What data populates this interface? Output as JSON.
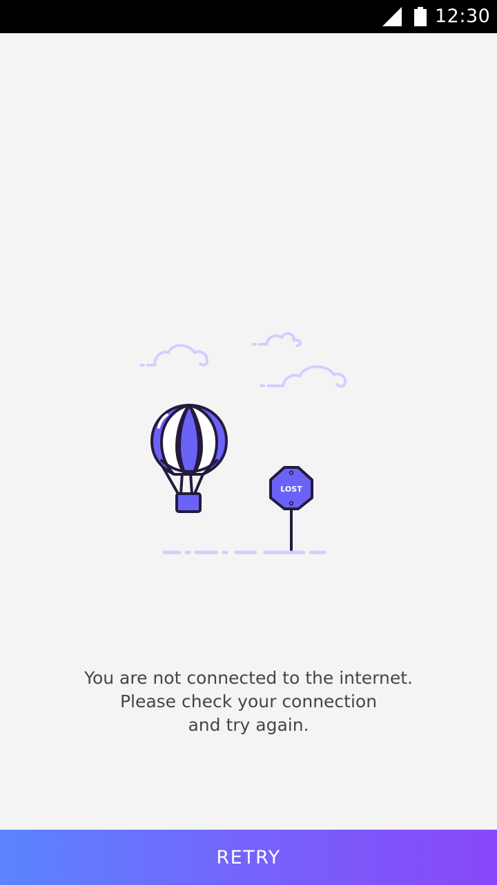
{
  "status_bar": {
    "time": "12:30",
    "icons": [
      "signal-icon",
      "battery-icon"
    ]
  },
  "illustration": {
    "sign_text": "LOST",
    "icons": [
      "cloud-icon",
      "hot-air-balloon-icon",
      "stop-sign-icon"
    ],
    "colors": {
      "balloon_fill": "#6b63f7",
      "outline": "#241a3d",
      "cloud": "#d9cbff",
      "ground_dash": "#d5cdfb"
    }
  },
  "message": {
    "line1": "You are not connected to the internet.",
    "line2": "Please check your connection",
    "line3": "and try again."
  },
  "retry_button": {
    "label": "RETRY",
    "gradient_start": "#5b85ff",
    "gradient_end": "#8848f9"
  }
}
